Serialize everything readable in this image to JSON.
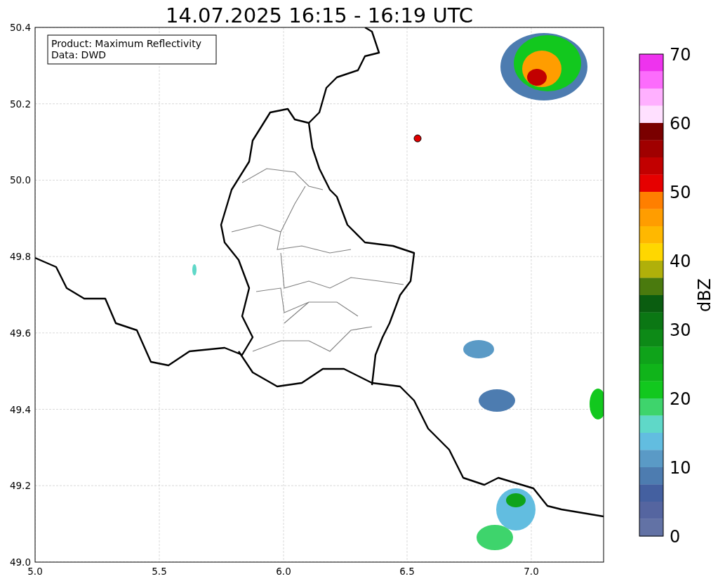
{
  "title": "14.07.2025 16:15 - 16:19 UTC",
  "info_box": [
    "Product: Maximum Reflectivity",
    "Data: DWD"
  ],
  "x_ticks": [
    "5.0",
    "5.5",
    "6.0",
    "6.5",
    "7.0"
  ],
  "y_ticks": [
    "50.4",
    "50.2",
    "50.0",
    "49.8",
    "49.6",
    "49.4",
    "49.2",
    "49.0"
  ],
  "colorbar": {
    "label": "dBZ",
    "ticks": [
      "70",
      "60",
      "50",
      "40",
      "30",
      "20",
      "10",
      "0"
    ],
    "segments": [
      {
        "color": "#ee33ee"
      },
      {
        "color": "#fc6cfc"
      },
      {
        "color": "#ffb0ff"
      },
      {
        "color": "#ffe0ff"
      },
      {
        "color": "#7a0000"
      },
      {
        "color": "#a00000"
      },
      {
        "color": "#c20000"
      },
      {
        "color": "#e60000"
      },
      {
        "color": "#ff7f00"
      },
      {
        "color": "#ff9d00"
      },
      {
        "color": "#ffb800"
      },
      {
        "color": "#ffd700"
      },
      {
        "color": "#b0b00a"
      },
      {
        "color": "#4a7a0e"
      },
      {
        "color": "#0a5d10"
      },
      {
        "color": "#0b7714"
      },
      {
        "color": "#0d8a17"
      },
      {
        "color": "#0fa31a"
      },
      {
        "color": "#10b41a"
      },
      {
        "color": "#12c81e"
      },
      {
        "color": "#3ed46c"
      },
      {
        "color": "#5fd8c8"
      },
      {
        "color": "#62bde0"
      },
      {
        "color": "#5a9ac6"
      },
      {
        "color": "#4d7cb0"
      },
      {
        "color": "#4460a0"
      },
      {
        "color": "#5565a0"
      },
      {
        "color": "#6272a5"
      }
    ]
  }
}
